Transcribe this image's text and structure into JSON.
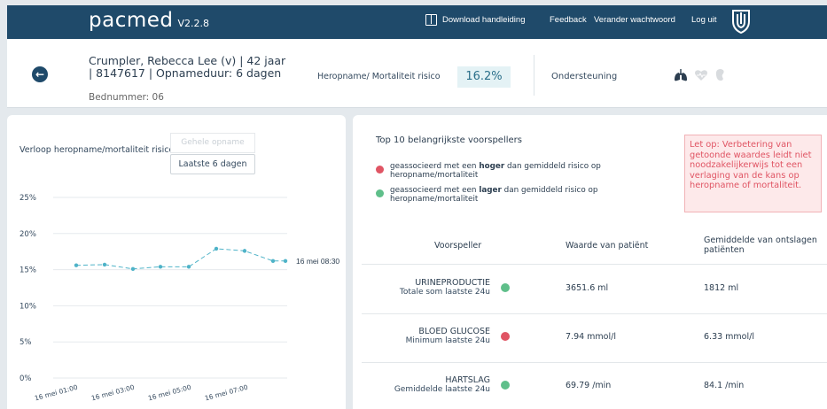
{
  "app": {
    "logo": "pacmed",
    "version": "V2.2.8"
  },
  "nav": {
    "manual": "Download handleiding",
    "feedback": "Feedback",
    "password": "Verander wachtwoord",
    "logout": "Log uit"
  },
  "patient": {
    "name_line": "Crumpler, Rebecca Lee (v) | 42 jaar | 8147617 | Opnameduur: 6 dagen",
    "bed": "Bednummer: 06",
    "risk_label": "Heropname/ Mortaliteit risico",
    "risk_value": "16.2%",
    "support_label": "Ondersteuning",
    "support_icons": [
      "lungs-icon",
      "heart-icon",
      "kidney-icon"
    ]
  },
  "chart_panel": {
    "title": "Verloop heropname/mortaliteit risico",
    "btn_full": "Gehele opname",
    "btn_last": "Laatste 6 dagen"
  },
  "chart_data": {
    "type": "line",
    "ylim": [
      0,
      25
    ],
    "yticks": [
      "25%",
      "20%",
      "15%",
      "10%",
      "5%",
      "0%"
    ],
    "xticks": [
      "16 mei 01:00",
      "16 mei 03:00",
      "16 mei 05:00",
      "16 mei 07:00"
    ],
    "series": [
      {
        "x": [
          "01:00",
          "02:00",
          "03:00",
          "04:00",
          "05:00",
          "06:00",
          "07:00",
          "08:00",
          "08:30"
        ],
        "values": [
          15.6,
          15.7,
          15.1,
          15.4,
          15.4,
          17.9,
          17.6,
          16.2,
          16.2
        ]
      }
    ],
    "end_label": "16 mei 08:30",
    "color": "#4fb3c8"
  },
  "predictors": {
    "title": "Top 10 belangrijkste voorspellers",
    "legend_high": "geassocieerd met een hoger dan gemiddeld risico op heropname/mortaliteit",
    "legend_low": "geassocieerd met een lager dan gemiddeld risico op heropname/mortaliteit",
    "warning": "Let op: Verbetering van getoonde waardes leidt niet noodzakelijkerwijs tot een verlaging van de kans op heropname of mortaliteit.",
    "col_predictor": "Voorspeller",
    "col_patient": "Waarde van patiënt",
    "col_mean": "Gemiddelde van ontslagen patiënten",
    "colors": {
      "high": "#e05564",
      "low": "#5fbf8a"
    },
    "rows": [
      {
        "name": "URINEPRODUCTIE",
        "sub": "Totale som laatste 24u",
        "status": "low",
        "value": "3651.6 ml",
        "mean": "1812 ml"
      },
      {
        "name": "BLOED GLUCOSE",
        "sub": "Minimum laatste 24u",
        "status": "high",
        "value": "7.94 mmol/l",
        "mean": "6.33 mmol/l"
      },
      {
        "name": "HARTSLAG",
        "sub": "Gemiddelde laatste 24u",
        "status": "low",
        "value": "69.79 /min",
        "mean": "84.1 /min"
      }
    ]
  }
}
